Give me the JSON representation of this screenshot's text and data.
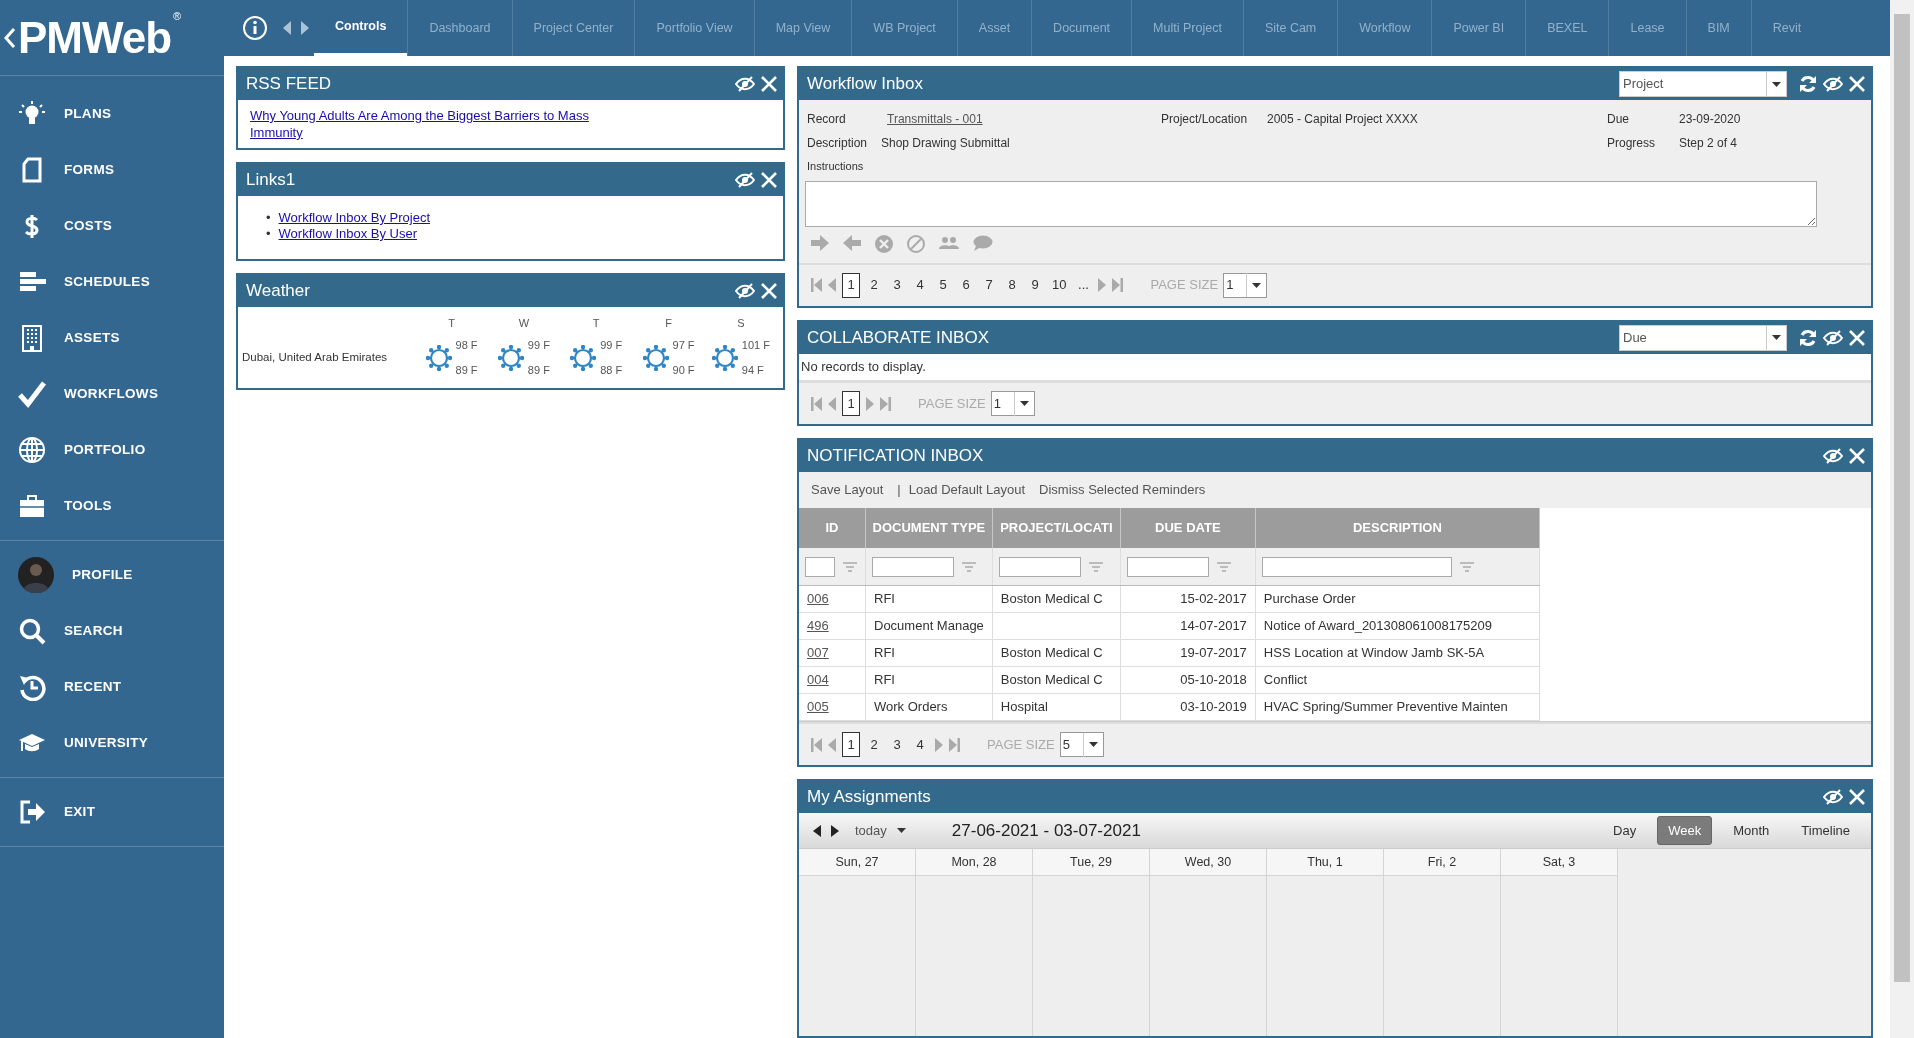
{
  "logo": {
    "text": "PMWeb",
    "mark": "®"
  },
  "top_tabs": [
    {
      "label": "Controls",
      "selected": true
    },
    {
      "label": "Dashboard",
      "selected": false
    },
    {
      "label": "Project Center",
      "selected": false
    },
    {
      "label": "Portfolio View",
      "selected": false
    },
    {
      "label": "Map View",
      "selected": false
    },
    {
      "label": "WB Project",
      "selected": false
    },
    {
      "label": "Asset",
      "selected": false
    },
    {
      "label": "Document",
      "selected": false
    },
    {
      "label": "Multi Project",
      "selected": false
    },
    {
      "label": "Site Cam",
      "selected": false
    },
    {
      "label": "Workflow",
      "selected": false
    },
    {
      "label": "Power BI",
      "selected": false
    },
    {
      "label": "BEXEL",
      "selected": false
    },
    {
      "label": "Lease",
      "selected": false
    },
    {
      "label": "BIM",
      "selected": false
    },
    {
      "label": "Revit",
      "selected": false
    }
  ],
  "sidebar": {
    "groups": [
      {
        "items": [
          "PLANS",
          "FORMS",
          "COSTS",
          "SCHEDULES",
          "ASSETS",
          "WORKFLOWS",
          "PORTFOLIO",
          "TOOLS"
        ]
      },
      {
        "items": [
          "PROFILE",
          "SEARCH",
          "RECENT",
          "UNIVERSITY"
        ]
      },
      {
        "items": [
          "EXIT"
        ]
      }
    ]
  },
  "rss_feed": {
    "title": "RSS FEED",
    "link": "Why Young Adults Are Among the Biggest Barriers to Mass Immunity"
  },
  "links": {
    "title": "Links1",
    "items": [
      {
        "bullet": "•",
        "label": "Workflow Inbox By Project"
      },
      {
        "bullet": "•",
        "label": "Workflow Inbox By User"
      }
    ]
  },
  "weather": {
    "title": "Weather",
    "location": "Dubai, United Arab Emirates",
    "days": [
      {
        "day": "T",
        "high": "98 F",
        "low": "89 F"
      },
      {
        "day": "W",
        "high": "99 F",
        "low": "89 F"
      },
      {
        "day": "T",
        "high": "99 F",
        "low": "88 F"
      },
      {
        "day": "F",
        "high": "97 F",
        "low": "90 F"
      },
      {
        "day": "S",
        "high": "101 F",
        "low": "94 F"
      }
    ]
  },
  "workflow_inbox": {
    "title": "Workflow Inbox",
    "filter": "Project",
    "record_label": "Record",
    "record": "Transmittals - 001",
    "project_label": "Project/Location",
    "project": "2005 - Capital Project XXXX",
    "due_label": "Due",
    "due": "23-09-2020",
    "description_label": "Description",
    "description": "Shop Drawing Submittal",
    "progress_label": "Progress",
    "progress": "Step 2 of 4",
    "instructions_label": "Instructions",
    "pager": {
      "pages": [
        {
          "label": "1",
          "selected": true
        },
        {
          "label": "2",
          "selected": false
        },
        {
          "label": "3",
          "selected": false
        },
        {
          "label": "4",
          "selected": false
        },
        {
          "label": "5",
          "selected": false
        },
        {
          "label": "6",
          "selected": false
        },
        {
          "label": "7",
          "selected": false
        },
        {
          "label": "8",
          "selected": false
        },
        {
          "label": "9",
          "selected": false
        },
        {
          "label": "10",
          "selected": false
        },
        {
          "label": "...",
          "selected": false
        }
      ],
      "page_size_label": "PAGE SIZE",
      "page_size": "1"
    }
  },
  "collaborate_inbox": {
    "title": "COLLABORATE INBOX",
    "filter": "Due",
    "message": "No records to display.",
    "pager": {
      "pages": [
        {
          "label": "1",
          "selected": true
        }
      ],
      "page_size_label": "PAGE SIZE",
      "page_size": "1"
    }
  },
  "notification_inbox": {
    "title": "NOTIFICATION INBOX",
    "toolbar": [
      {
        "kind": "link",
        "label": "Save Layout"
      },
      {
        "kind": "separator",
        "label": "|"
      },
      {
        "kind": "link",
        "label": "Load Default Layout"
      },
      {
        "kind": "link",
        "label": "Dismiss Selected Reminders"
      }
    ],
    "columns": [
      "ID",
      "DOCUMENT TYPE",
      "PROJECT/LOCATI",
      "DUE DATE",
      "DESCRIPTION"
    ],
    "rows": [
      {
        "id": "006",
        "document_type": "RFI",
        "project": "Boston Medical C",
        "due_date": "15-02-2017",
        "description": "Purchase Order"
      },
      {
        "id": "496",
        "document_type": "Document Manage",
        "due_date": "14-07-2017",
        "description": "Notice of Award_201308061008175209"
      },
      {
        "id": "007",
        "document_type": "RFI",
        "project": "Boston Medical C",
        "due_date": "19-07-2017",
        "description": "HSS Location at Window Jamb SK-5A"
      },
      {
        "id": "004",
        "document_type": "RFI",
        "project": "Boston Medical C",
        "due_date": "05-10-2018",
        "description": "Conflict"
      },
      {
        "id": "005",
        "document_type": "Work Orders",
        "project": "Hospital",
        "due_date": "03-10-2019",
        "description": "HVAC Spring/Summer Preventive Mainten"
      }
    ],
    "pager": {
      "pages": [
        {
          "label": "1",
          "selected": true
        },
        {
          "label": "2",
          "selected": false
        },
        {
          "label": "3",
          "selected": false
        },
        {
          "label": "4",
          "selected": false
        }
      ],
      "page_size_label": "PAGE SIZE",
      "page_size": "5"
    }
  },
  "my_assignments": {
    "title": "My Assignments",
    "today": "today",
    "range": "27-06-2021 - 03-07-2021",
    "views": [
      {
        "label": "Day",
        "selected": false
      },
      {
        "label": "Week",
        "selected": true
      },
      {
        "label": "Month",
        "selected": false
      },
      {
        "label": "Timeline",
        "selected": false
      }
    ],
    "days": [
      "Sun, 27",
      "Mon, 28",
      "Tue, 29",
      "Wed, 30",
      "Thu, 1",
      "Fri, 2",
      "Sat, 3"
    ]
  }
}
